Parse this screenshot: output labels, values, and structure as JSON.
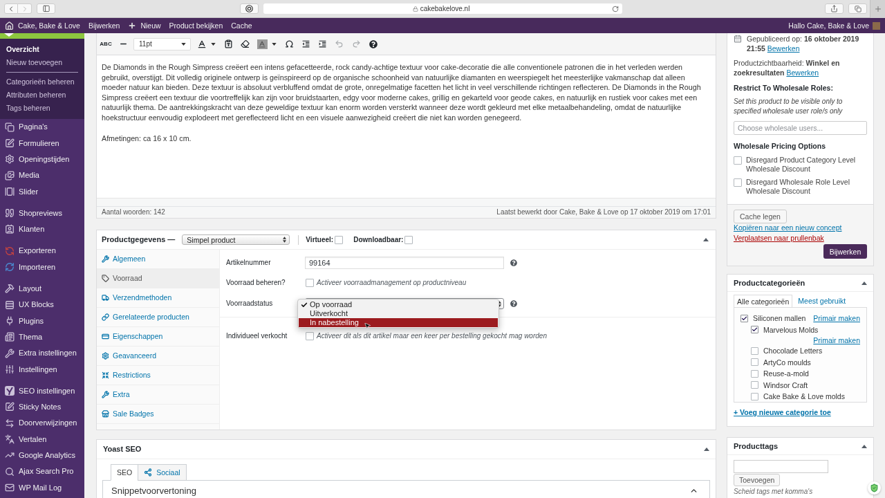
{
  "browser": {
    "url": "cakebakelove.nl",
    "back_disabled": false,
    "forward_disabled": true
  },
  "admin_bar": {
    "items": [
      "Cake, Bake & Love",
      "Bijwerken",
      "Nieuw",
      "Product bekijken",
      "Cache"
    ],
    "greeting": "Hallo Cake, Bake & Love"
  },
  "sidebar": {
    "submenu": [
      [
        {
          "label": "Overzicht",
          "selected": true
        },
        {
          "label": "Nieuw toevoegen",
          "selected": false
        }
      ],
      [
        {
          "label": "Categorieën beheren",
          "selected": false
        },
        {
          "label": "Attributen beheren",
          "selected": false
        },
        {
          "label": "Tags beheren",
          "selected": false
        }
      ]
    ],
    "menu": [
      [
        "Pagina's",
        "Formulieren",
        "Openingstijden",
        "Media",
        "Slider"
      ],
      [
        "Shopreviews",
        "Klanten"
      ],
      [
        "Exporteren",
        "Importeren"
      ],
      [
        "Layout",
        "UX Blocks",
        "Plugins",
        "Thema",
        "Extra instellingen",
        "Instellingen"
      ],
      [
        "SEO instellingen",
        "Sticky Notes",
        "Doorverwijzingen",
        "Vertalen",
        "Google Analytics",
        "Ajax Search Pro",
        "WP Mail Log"
      ]
    ]
  },
  "editor": {
    "toolbar": {
      "strike_label": "ABC",
      "font_size": "11pt",
      "undo_disabled": true,
      "redo_disabled": true
    },
    "content": [
      "De Diamonds in the Rough Simpress creëert een intens gefacetteerde, rock candy-achtige textuur voor cake-decoratie die alle conventionele patronen die in het verleden werden gebruikt, overstijgt. Dit volledig originele ontwerp is geïnspireerd op de organische schoonheid van natuurlijke diamanten en weerspiegelt het meesterlijke vakmanschap dat alleen moeder natuur kan bieden. Deze textuur is absoluut verbluffend omdat de grote, onregelmatige facetten het licht in veel verschillende richtingen reflecteren. De Diamonds in the Rough Simpress creëert een textuur die voortreffelijk kan zijn voor bruidstaarten, edgy voor moderne cakes, grillig en gekarteld voor geode cakes, en natuurlijk en rustiek voor cakes met een natuurlijk thema. De aantrekkingskracht van deze geweldige textuur kan enorm worden versterkt wanneer deze wordt gekleurd met elke metaalbehandeling, omdat de natuurlijke hoekstructuur eenvoudig explodeert met gereflecteerd licht en een visuele aanwezigheid creëert die niet kan worden genegeerd.",
      "Afmetingen: ca 16 x 10 cm."
    ],
    "word_count": "Aantal woorden: 142",
    "last_edited": "Laatst bewerkt door Cake, Bake & Love op 17 oktober 2019 om 17:01"
  },
  "product_data": {
    "title": "Productgegevens —",
    "product_type": "Simpel product",
    "options": [
      {
        "label": "Virtueel:",
        "checked": false
      },
      {
        "label": "Downloadbaar:",
        "checked": false
      }
    ],
    "expanded": true,
    "tabs": [
      {
        "label": "Algemeen",
        "selected": false
      },
      {
        "label": "Voorraad",
        "selected": true
      },
      {
        "label": "Verzendmethoden",
        "selected": false
      },
      {
        "label": "Gerelateerde producten",
        "selected": false
      },
      {
        "label": "Eigenschappen",
        "selected": false
      },
      {
        "label": "Geavanceerd",
        "selected": false
      },
      {
        "label": "Restrictions",
        "selected": false
      },
      {
        "label": "Extra",
        "selected": false
      },
      {
        "label": "Sale Badges",
        "selected": false
      }
    ],
    "groups": [
      [
        {
          "kind": "text",
          "label": "Artikelnummer",
          "value": "99164",
          "help": true
        },
        {
          "kind": "checkbox",
          "label": "Voorraad beheren?",
          "checked": false,
          "description": "Activeer voorraadmanagement op productniveau",
          "help": false
        },
        {
          "kind": "select",
          "label": "Voorraadstatus",
          "expanded": true,
          "help": true,
          "options": [
            {
              "label": "Op voorraad",
              "selected": true,
              "hovered": false
            },
            {
              "label": "Uitverkocht",
              "selected": false,
              "hovered": false
            },
            {
              "label": "In nabestelling",
              "selected": false,
              "hovered": true
            }
          ]
        }
      ],
      [
        {
          "kind": "checkbox",
          "label": "Individueel verkocht",
          "checked": false,
          "description": "Activeer dit als dit artikel maar een keer per bestelling gekocht mag worden",
          "help": false
        }
      ]
    ]
  },
  "yoast": {
    "title": "Yoast SEO",
    "expanded": true,
    "tabs": [
      {
        "label": "SEO",
        "selected": true
      },
      {
        "label": "Sociaal",
        "selected": false
      }
    ],
    "section": "Snippetvoorvertoning",
    "section_expanded": true
  },
  "publish": {
    "published": "Gepubliceerd op: **16 oktober 2019 21:55**",
    "published_link": "Bewerken",
    "visibility": "Productzichtbaarheid: **Winkel en zoekresultaten**",
    "visibility_link": "Bewerken",
    "wholesale_title": "Restrict To Wholesale Roles:",
    "wholesale_note": "Set this product to be visible only to specified wholesale user role/s only",
    "wholesale_placeholder": "Choose wholesale users...",
    "pricing_title": "Wholesale Pricing Options",
    "pricing_options": [
      {
        "label": "Disregard Product Category Level Wholesale Discount",
        "checked": false
      },
      {
        "label": "Disregard Wholesale Role Level Wholesale Discount",
        "checked": false
      }
    ],
    "clear_cache": "Cache legen",
    "copy_link": "Kopiëren naar een nieuw concept",
    "trash_link": "Verplaatsen naar prullenbak",
    "update": "Bijwerken"
  },
  "categories": {
    "title": "Productcategorieën",
    "expanded": true,
    "tabs": [
      {
        "label": "Alle categorieën",
        "selected": true
      },
      {
        "label": "Meest gebruikt",
        "selected": false
      }
    ],
    "items": [
      {
        "label": "Siliconen mallen",
        "checked": true,
        "primary_link": "Primair maken",
        "children": [
          {
            "label": "Marvelous Molds",
            "checked": true,
            "primary_link": "Primair maken"
          },
          {
            "label": "Chocolade Letters",
            "checked": false
          },
          {
            "label": "ArtyCo moulds",
            "checked": false
          },
          {
            "label": "Reuse-a-mold",
            "checked": false
          },
          {
            "label": "Windsor Craft",
            "checked": false
          },
          {
            "label": "Cake Bake & Love molds",
            "checked": false
          }
        ]
      }
    ],
    "add_link": "+ Voeg nieuwe categorie toe"
  },
  "tags": {
    "title": "Producttags",
    "expanded": true,
    "button": "Toevoegen",
    "hint": "Scheid tags met komma's"
  }
}
